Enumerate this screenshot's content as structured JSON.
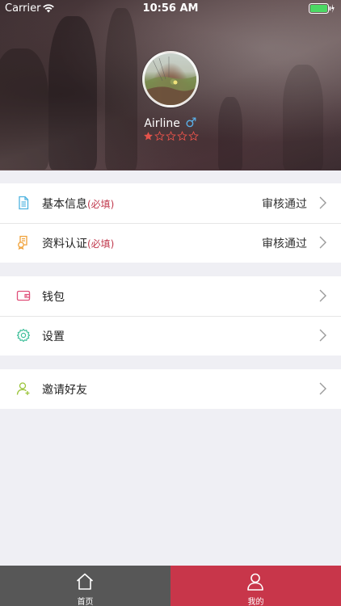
{
  "status_bar": {
    "carrier": "Carrier",
    "time": "10:56 AM"
  },
  "profile": {
    "username": "Airline",
    "gender_icon": "male-symbol-icon",
    "rating": 1,
    "rating_max": 5
  },
  "menu": {
    "group1": [
      {
        "icon": "document-icon",
        "label": "基本信息",
        "required": "(必填)",
        "status": "审核通过"
      },
      {
        "icon": "certification-icon",
        "label": "资料认证",
        "required": "(必填)",
        "status": "审核通过"
      }
    ],
    "group2": [
      {
        "icon": "wallet-icon",
        "label": "钱包"
      },
      {
        "icon": "gear-icon",
        "label": "设置"
      }
    ],
    "group3": [
      {
        "icon": "add-user-icon",
        "label": "邀请好友"
      }
    ]
  },
  "tabbar": {
    "home": {
      "label": "首页",
      "icon": "home-icon"
    },
    "me": {
      "label": "我的",
      "icon": "person-icon",
      "active": true
    }
  },
  "colors": {
    "accent": "#c8364a",
    "tab_inactive_bg": "#575757",
    "star": "#e5534b",
    "gender": "#5ab0e8"
  }
}
